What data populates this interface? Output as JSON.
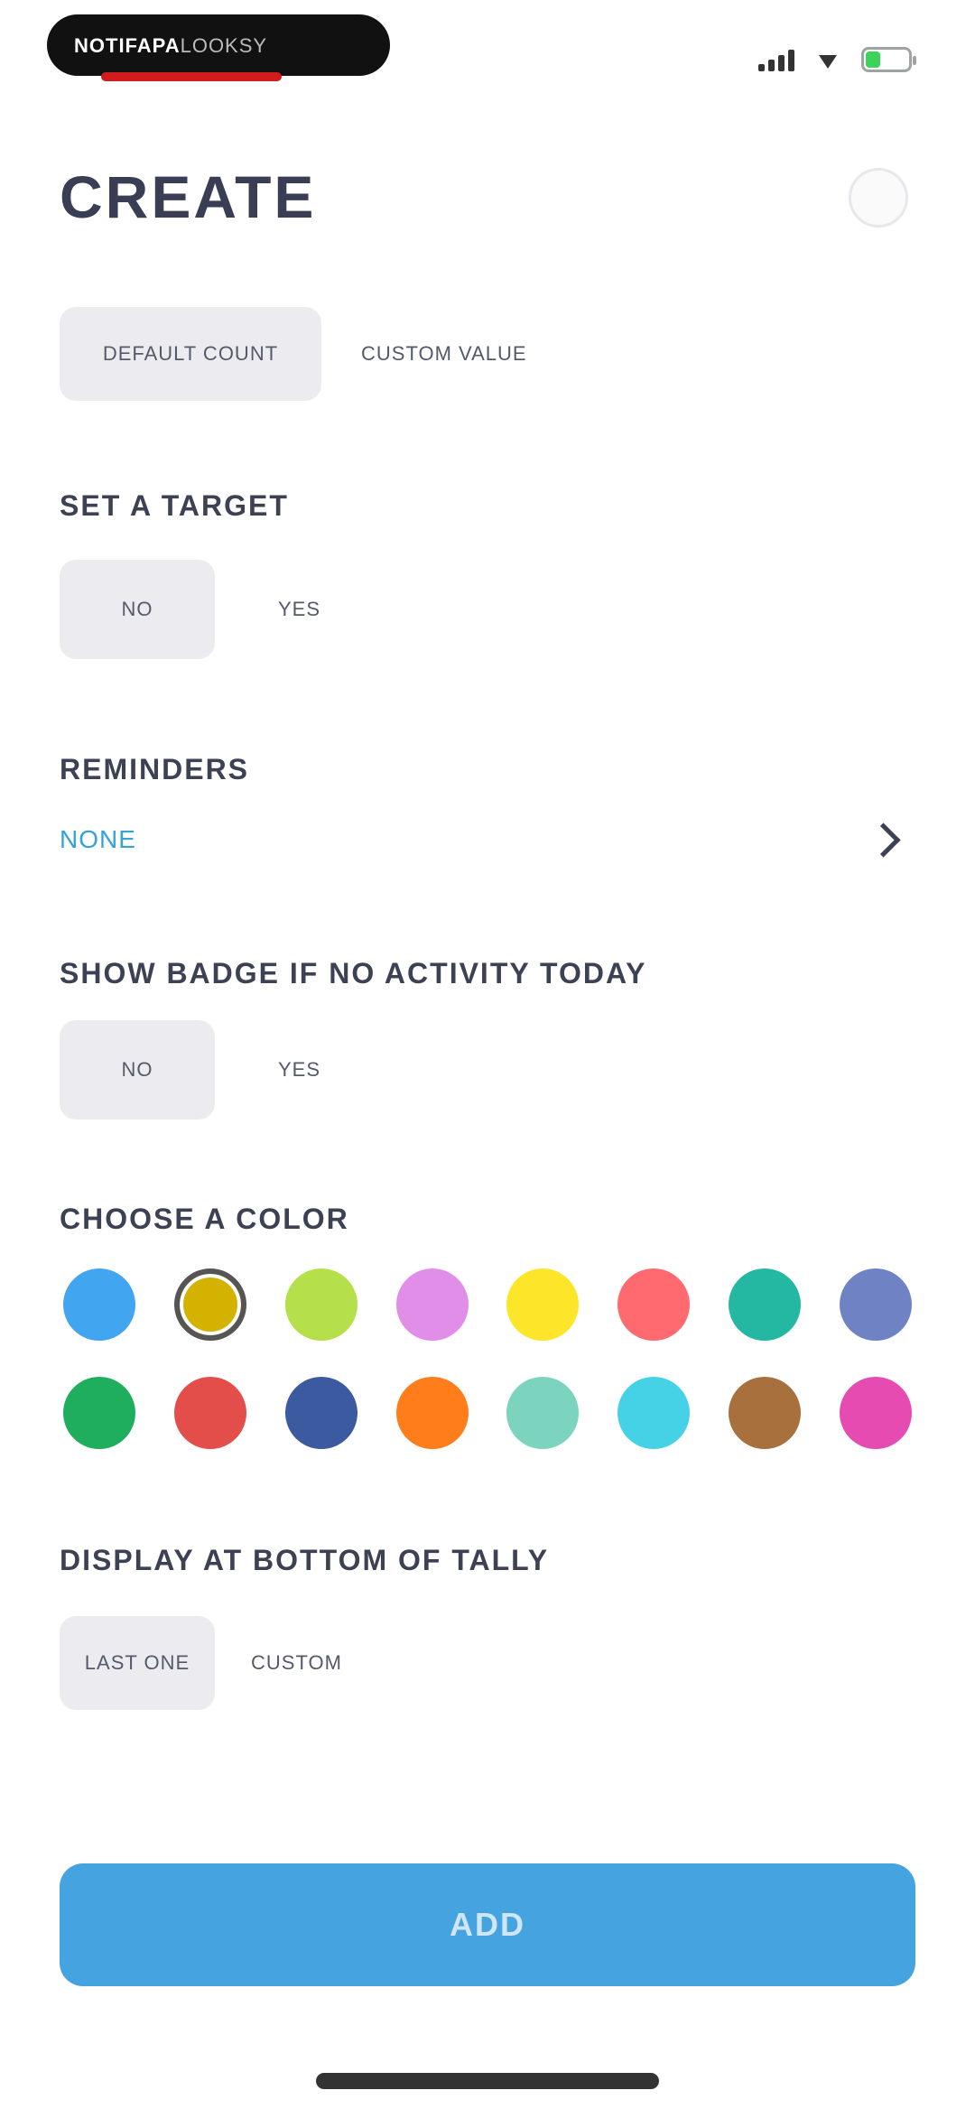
{
  "status_bar": {
    "app_label": "NOTIFAPA",
    "app_label_sub": "LOOKSY",
    "battery_level": 0.35
  },
  "page": {
    "title": "CREATE"
  },
  "count_type": {
    "selected": "DEFAULT COUNT",
    "other": "CUSTOM VALUE"
  },
  "target": {
    "label": "SET A TARGET",
    "selected": "NO",
    "other": "YES"
  },
  "reminders": {
    "label": "REMINDERS",
    "value": "NONE"
  },
  "badge": {
    "label": "SHOW BADGE IF NO ACTIVITY TODAY",
    "selected": "NO",
    "other": "YES"
  },
  "color": {
    "label": "CHOOSE A COLOR",
    "selected_index": 1,
    "swatches": [
      "#42a5f0",
      "#d4b300",
      "#b5e04a",
      "#e08ee8",
      "#fde52a",
      "#ff6a70",
      "#24b7a2",
      "#6e82c4",
      "#1fae5d",
      "#e34d4a",
      "#3c5aa0",
      "#ff7d1a",
      "#7cd4bf",
      "#45d2e6",
      "#a8703c",
      "#e64bb2"
    ]
  },
  "display": {
    "label": "DISPLAY AT BOTTOM OF TALLY",
    "selected": "LAST ONE",
    "other": "CUSTOM"
  },
  "add_button": {
    "label": "ADD"
  }
}
